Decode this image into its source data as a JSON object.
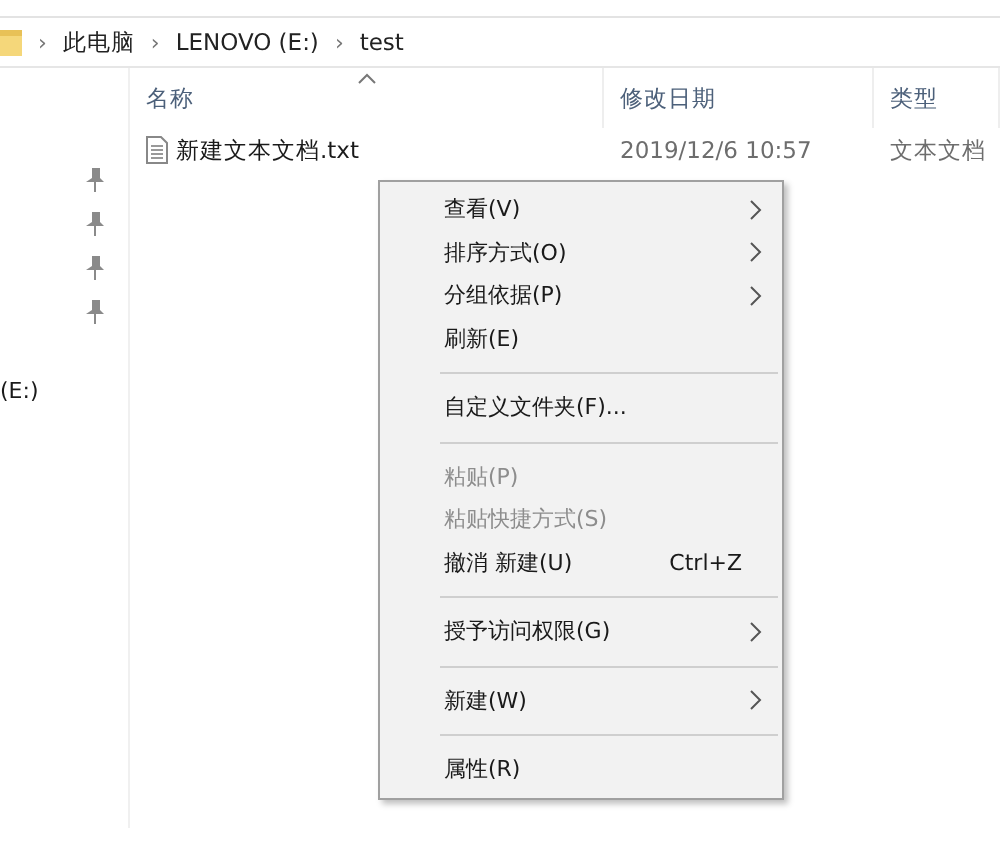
{
  "address_bar": {
    "crumbs": [
      "此电脑",
      "LENOVO (E:)",
      "test"
    ],
    "separator": "›"
  },
  "navigation_pane": {
    "items": [
      "(E:)"
    ]
  },
  "file_list": {
    "columns": [
      {
        "label": "名称",
        "sorted": true
      },
      {
        "label": "修改日期",
        "sorted": false
      },
      {
        "label": "类型",
        "sorted": false
      }
    ],
    "rows": [
      {
        "name": "新建文本文档.txt",
        "modified": "2019/12/6 10:57",
        "type": "文本文档"
      }
    ]
  },
  "context_menu": {
    "items": [
      {
        "kind": "item",
        "label": "查看(V)",
        "submenu": true,
        "disabled": false
      },
      {
        "kind": "item",
        "label": "排序方式(O)",
        "submenu": true,
        "disabled": false
      },
      {
        "kind": "item",
        "label": "分组依据(P)",
        "submenu": true,
        "disabled": false
      },
      {
        "kind": "item",
        "label": "刷新(E)",
        "submenu": false,
        "disabled": false
      },
      {
        "kind": "separator"
      },
      {
        "kind": "item",
        "label": "自定义文件夹(F)...",
        "submenu": false,
        "disabled": false
      },
      {
        "kind": "separator"
      },
      {
        "kind": "item",
        "label": "粘贴(P)",
        "submenu": false,
        "disabled": true
      },
      {
        "kind": "item",
        "label": "粘贴快捷方式(S)",
        "submenu": false,
        "disabled": true
      },
      {
        "kind": "item",
        "label": "撤消 新建(U)",
        "shortcut": "Ctrl+Z",
        "submenu": false,
        "disabled": false
      },
      {
        "kind": "separator"
      },
      {
        "kind": "item",
        "label": "授予访问权限(G)",
        "submenu": true,
        "disabled": false
      },
      {
        "kind": "separator"
      },
      {
        "kind": "item",
        "label": "新建(W)",
        "submenu": true,
        "disabled": false
      },
      {
        "kind": "separator"
      },
      {
        "kind": "item",
        "label": "属性(R)",
        "submenu": false,
        "disabled": false
      }
    ]
  }
}
